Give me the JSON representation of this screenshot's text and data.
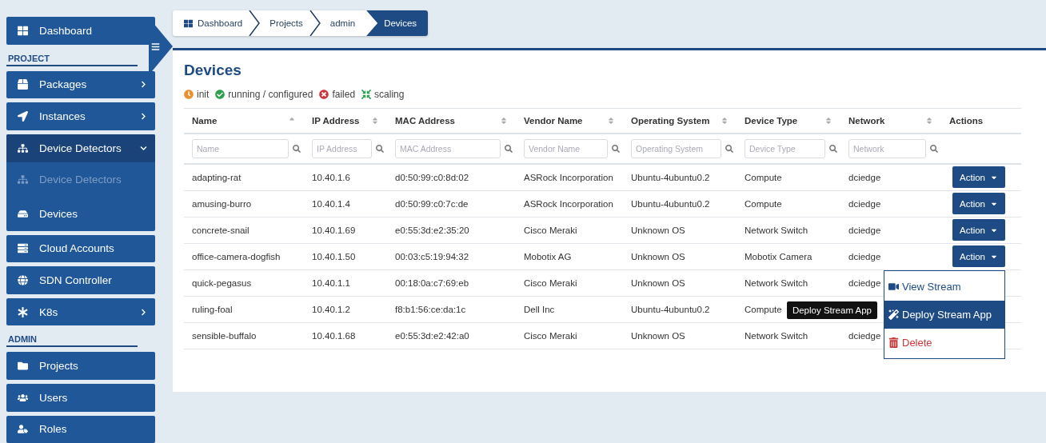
{
  "sidebar": [
    {
      "kind": "link",
      "label": "Dashboard"
    },
    {
      "kind": "section",
      "label": "PROJECT"
    },
    {
      "kind": "link",
      "label": "Packages",
      "expanded": false
    },
    {
      "kind": "link",
      "label": "Instances",
      "expanded": false
    },
    {
      "kind": "link",
      "label": "Device Detectors",
      "expanded": true,
      "children": [
        {
          "label": "Device Detectors",
          "disabled": true
        },
        {
          "label": "Devices",
          "disabled": false
        }
      ]
    },
    {
      "kind": "link",
      "label": "Cloud Accounts"
    },
    {
      "kind": "link",
      "label": "SDN Controller"
    },
    {
      "kind": "link",
      "label": "K8s",
      "expanded": false
    },
    {
      "kind": "section",
      "label": "ADMIN"
    },
    {
      "kind": "link",
      "label": "Projects"
    },
    {
      "kind": "link",
      "label": "Users"
    },
    {
      "kind": "link",
      "label": "Roles"
    }
  ],
  "breadcrumb": [
    {
      "label": "Dashboard",
      "selected": false
    },
    {
      "label": "Projects",
      "selected": false
    },
    {
      "label": "admin",
      "selected": false
    },
    {
      "label": "Devices",
      "selected": true
    }
  ],
  "page_title": "Devices",
  "legend": [
    {
      "label": "init",
      "color": "#e8912d"
    },
    {
      "label": "running / configured",
      "color": "#2e9e4f"
    },
    {
      "label": "failed",
      "color": "#c8383c"
    },
    {
      "label": "scaling",
      "color": "#2e9e4f"
    }
  ],
  "table": {
    "columns": [
      {
        "label": "Name",
        "sorted": true,
        "placeholder": "Name"
      },
      {
        "label": "IP Address",
        "sorted": false,
        "placeholder": "IP Address"
      },
      {
        "label": "MAC Address",
        "sorted": false,
        "placeholder": "MAC Address"
      },
      {
        "label": "Vendor Name",
        "sorted": false,
        "placeholder": "Vendor Name"
      },
      {
        "label": "Operating System",
        "sorted": false,
        "placeholder": "Operating System"
      },
      {
        "label": "Device Type",
        "sorted": false,
        "placeholder": "Device Type"
      },
      {
        "label": "Network",
        "sorted": false,
        "placeholder": "Network"
      },
      {
        "label": "Actions"
      }
    ],
    "rows": [
      {
        "cells": [
          "adapting-rat",
          "10.40.1.6",
          "d0:50:99:c0:8d:02",
          "ASRock Incorporation",
          "Ubuntu-4ubuntu0.2",
          "Compute",
          "dciedge"
        ],
        "action": "Action"
      },
      {
        "cells": [
          "amusing-burro",
          "10.40.1.4",
          "d0:50:99:c0:7c:de",
          "ASRock Incorporation",
          "Ubuntu-4ubuntu0.2",
          "Compute",
          "dciedge"
        ],
        "action": "Action"
      },
      {
        "cells": [
          "concrete-snail",
          "10.40.1.69",
          "e0:55:3d:e2:35:20",
          "Cisco Meraki",
          "Unknown OS",
          "Network Switch",
          "dciedge"
        ],
        "action": "Action"
      },
      {
        "cells": [
          "office-camera-dogfish",
          "10.40.1.50",
          "00:03:c5:19:94:32",
          "Mobotix AG",
          "Unknown OS",
          "Mobotix Camera",
          "dciedge"
        ],
        "action": "Action",
        "menu": {
          "items": [
            {
              "label": "View Stream",
              "kind": "normal",
              "selected": false
            },
            {
              "label": "Deploy Stream App",
              "kind": "normal",
              "selected": true
            },
            {
              "label": "Delete",
              "kind": "danger",
              "selected": false
            }
          ],
          "tooltip": "Deploy Stream App"
        }
      },
      {
        "cells": [
          "quick-pegasus",
          "10.40.1.1",
          "00:18:0a:c7:69:eb",
          "Cisco Meraki",
          "Unknown OS",
          "Network Switch",
          "dciedge"
        ]
      },
      {
        "cells": [
          "ruling-foal",
          "10.40.1.2",
          "f8:b1:56:ce:da:1c",
          "Dell Inc",
          "Ubuntu-4ubuntu0.2",
          "Compute"
        ]
      },
      {
        "cells": [
          "sensible-buffalo",
          "10.40.1.68",
          "e0:55:3d:e2:42:a0",
          "Cisco Meraki",
          "Unknown OS",
          "Network Switch",
          "dciedge"
        ]
      }
    ]
  }
}
